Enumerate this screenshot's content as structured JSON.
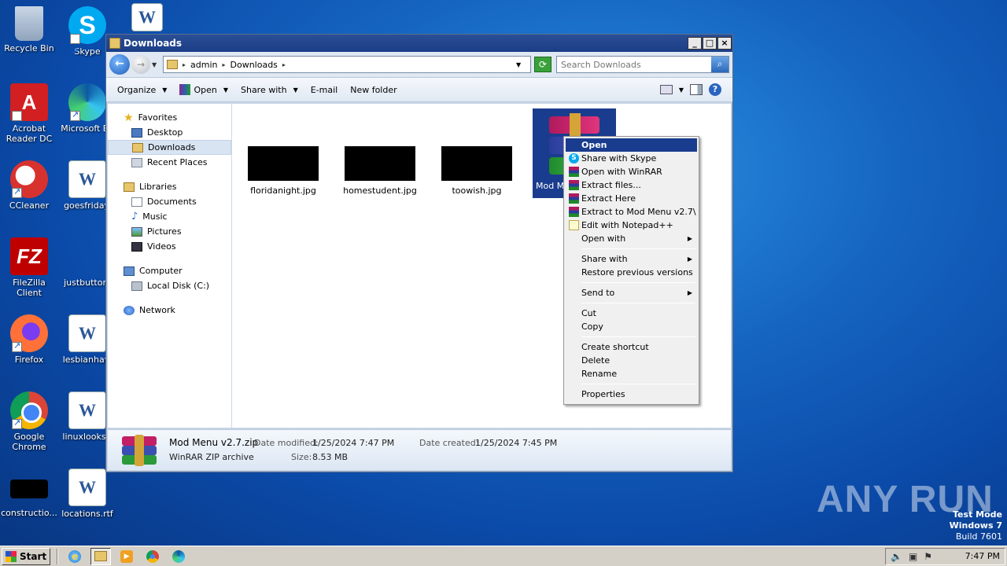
{
  "desktop": {
    "icons": [
      {
        "label": "Recycle Bin"
      },
      {
        "label": "Skype"
      },
      {
        "label": "Acrobat Reader DC"
      },
      {
        "label": "Microsoft Ed"
      },
      {
        "label": "CCleaner"
      },
      {
        "label": "goesfriday."
      },
      {
        "label": "FileZilla Client"
      },
      {
        "label": "justbutton."
      },
      {
        "label": "Firefox"
      },
      {
        "label": "lesbianhavi"
      },
      {
        "label": "Google Chrome"
      },
      {
        "label": "linuxlooks.r"
      },
      {
        "label": "constructio..."
      },
      {
        "label": "locations.rtf"
      }
    ]
  },
  "window": {
    "title": "Downloads",
    "address": {
      "crumbs": [
        "admin",
        "Downloads"
      ]
    },
    "search": {
      "placeholder": "Search Downloads"
    },
    "toolbar": {
      "organize": "Organize",
      "open": "Open",
      "share_with": "Share with",
      "email": "E-mail",
      "new_folder": "New folder"
    },
    "nav": {
      "favorites": "Favorites",
      "desktop": "Desktop",
      "downloads": "Downloads",
      "recent_places": "Recent Places",
      "libraries": "Libraries",
      "documents": "Documents",
      "music": "Music",
      "pictures": "Pictures",
      "videos": "Videos",
      "computer": "Computer",
      "local_disk": "Local Disk (C:)",
      "network": "Network"
    },
    "files": [
      {
        "name": "floridanight.jpg"
      },
      {
        "name": "homestudent.jpg"
      },
      {
        "name": "toowish.jpg"
      },
      {
        "name": "Mod M"
      }
    ],
    "details": {
      "name": "Mod Menu v2.7.zip",
      "modified_label": "Date modified:",
      "modified_value": "1/25/2024 7:47 PM",
      "created_label": "Date created:",
      "created_value": "1/25/2024 7:45 PM",
      "type": "WinRAR ZIP archive",
      "size_label": "Size:",
      "size_value": "8.53 MB"
    }
  },
  "context_menu": {
    "items": [
      "Open",
      "Share with Skype",
      "Open with WinRAR",
      "Extract files...",
      "Extract Here",
      "Extract to Mod Menu v2.7\\",
      "Edit with Notepad++",
      "Open with",
      "Share with",
      "Restore previous versions",
      "Send to",
      "Cut",
      "Copy",
      "Create shortcut",
      "Delete",
      "Rename",
      "Properties"
    ]
  },
  "taskbar": {
    "start": "Start",
    "clock": "7:47 PM"
  },
  "watermark": "ANY RUN",
  "test_mode": {
    "line1": "Test Mode",
    "line2": "Windows 7",
    "line3": "Build 7601"
  },
  "colors": {
    "selection": "#1a3c8e",
    "titlebar": "#1b3d86",
    "desktop": "#1565c0"
  }
}
